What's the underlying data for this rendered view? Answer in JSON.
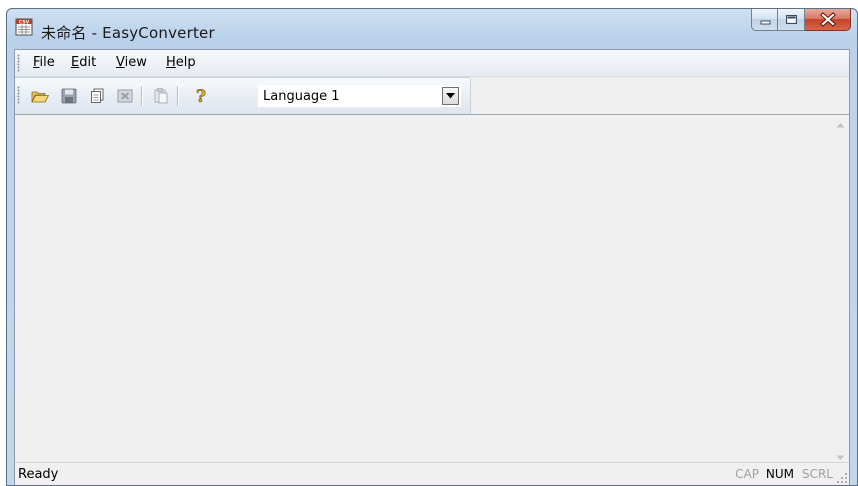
{
  "window": {
    "title": "未命名 - EasyConverter",
    "app_icon": "csv-app-icon",
    "caption_buttons": [
      "minimize-icon",
      "maximize-icon",
      "close-icon"
    ]
  },
  "menu": {
    "items": [
      {
        "label_ul": "F",
        "label_rest": "ile"
      },
      {
        "label_ul": "E",
        "label_rest": "dit"
      },
      {
        "label_ul": "V",
        "label_rest": "iew"
      },
      {
        "label_ul": "H",
        "label_rest": "elp"
      }
    ]
  },
  "toolbar": {
    "buttons": [
      "open-folder-icon",
      "save-disk-icon",
      "copy-pages-icon",
      "delete-icon",
      "paste-icon",
      "help-question-icon"
    ],
    "language_select": {
      "value": "Language 1"
    }
  },
  "status": {
    "text": "Ready",
    "indicators": [
      {
        "label": "CAP",
        "active": false
      },
      {
        "label": "NUM",
        "active": true
      },
      {
        "label": "SCRL",
        "active": false
      }
    ]
  },
  "colors": {
    "title_bg": "#bcd3ea",
    "close_button": "#c5432a",
    "client_bg": "#f0f0f0"
  }
}
